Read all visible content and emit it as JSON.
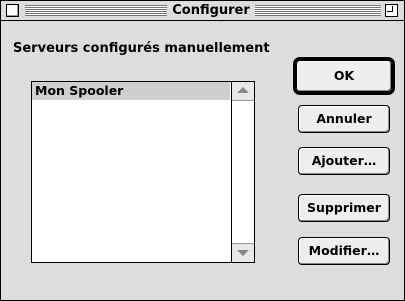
{
  "window": {
    "title": "Configurer"
  },
  "section": {
    "label": "Serveurs configurés manuellement"
  },
  "server_list": {
    "items": [
      "Mon Spooler"
    ],
    "selected_index": 0
  },
  "buttons": {
    "ok": "OK",
    "cancel": "Annuler",
    "add": "Ajouter…",
    "remove": "Supprimer",
    "modify": "Modifier…"
  }
}
